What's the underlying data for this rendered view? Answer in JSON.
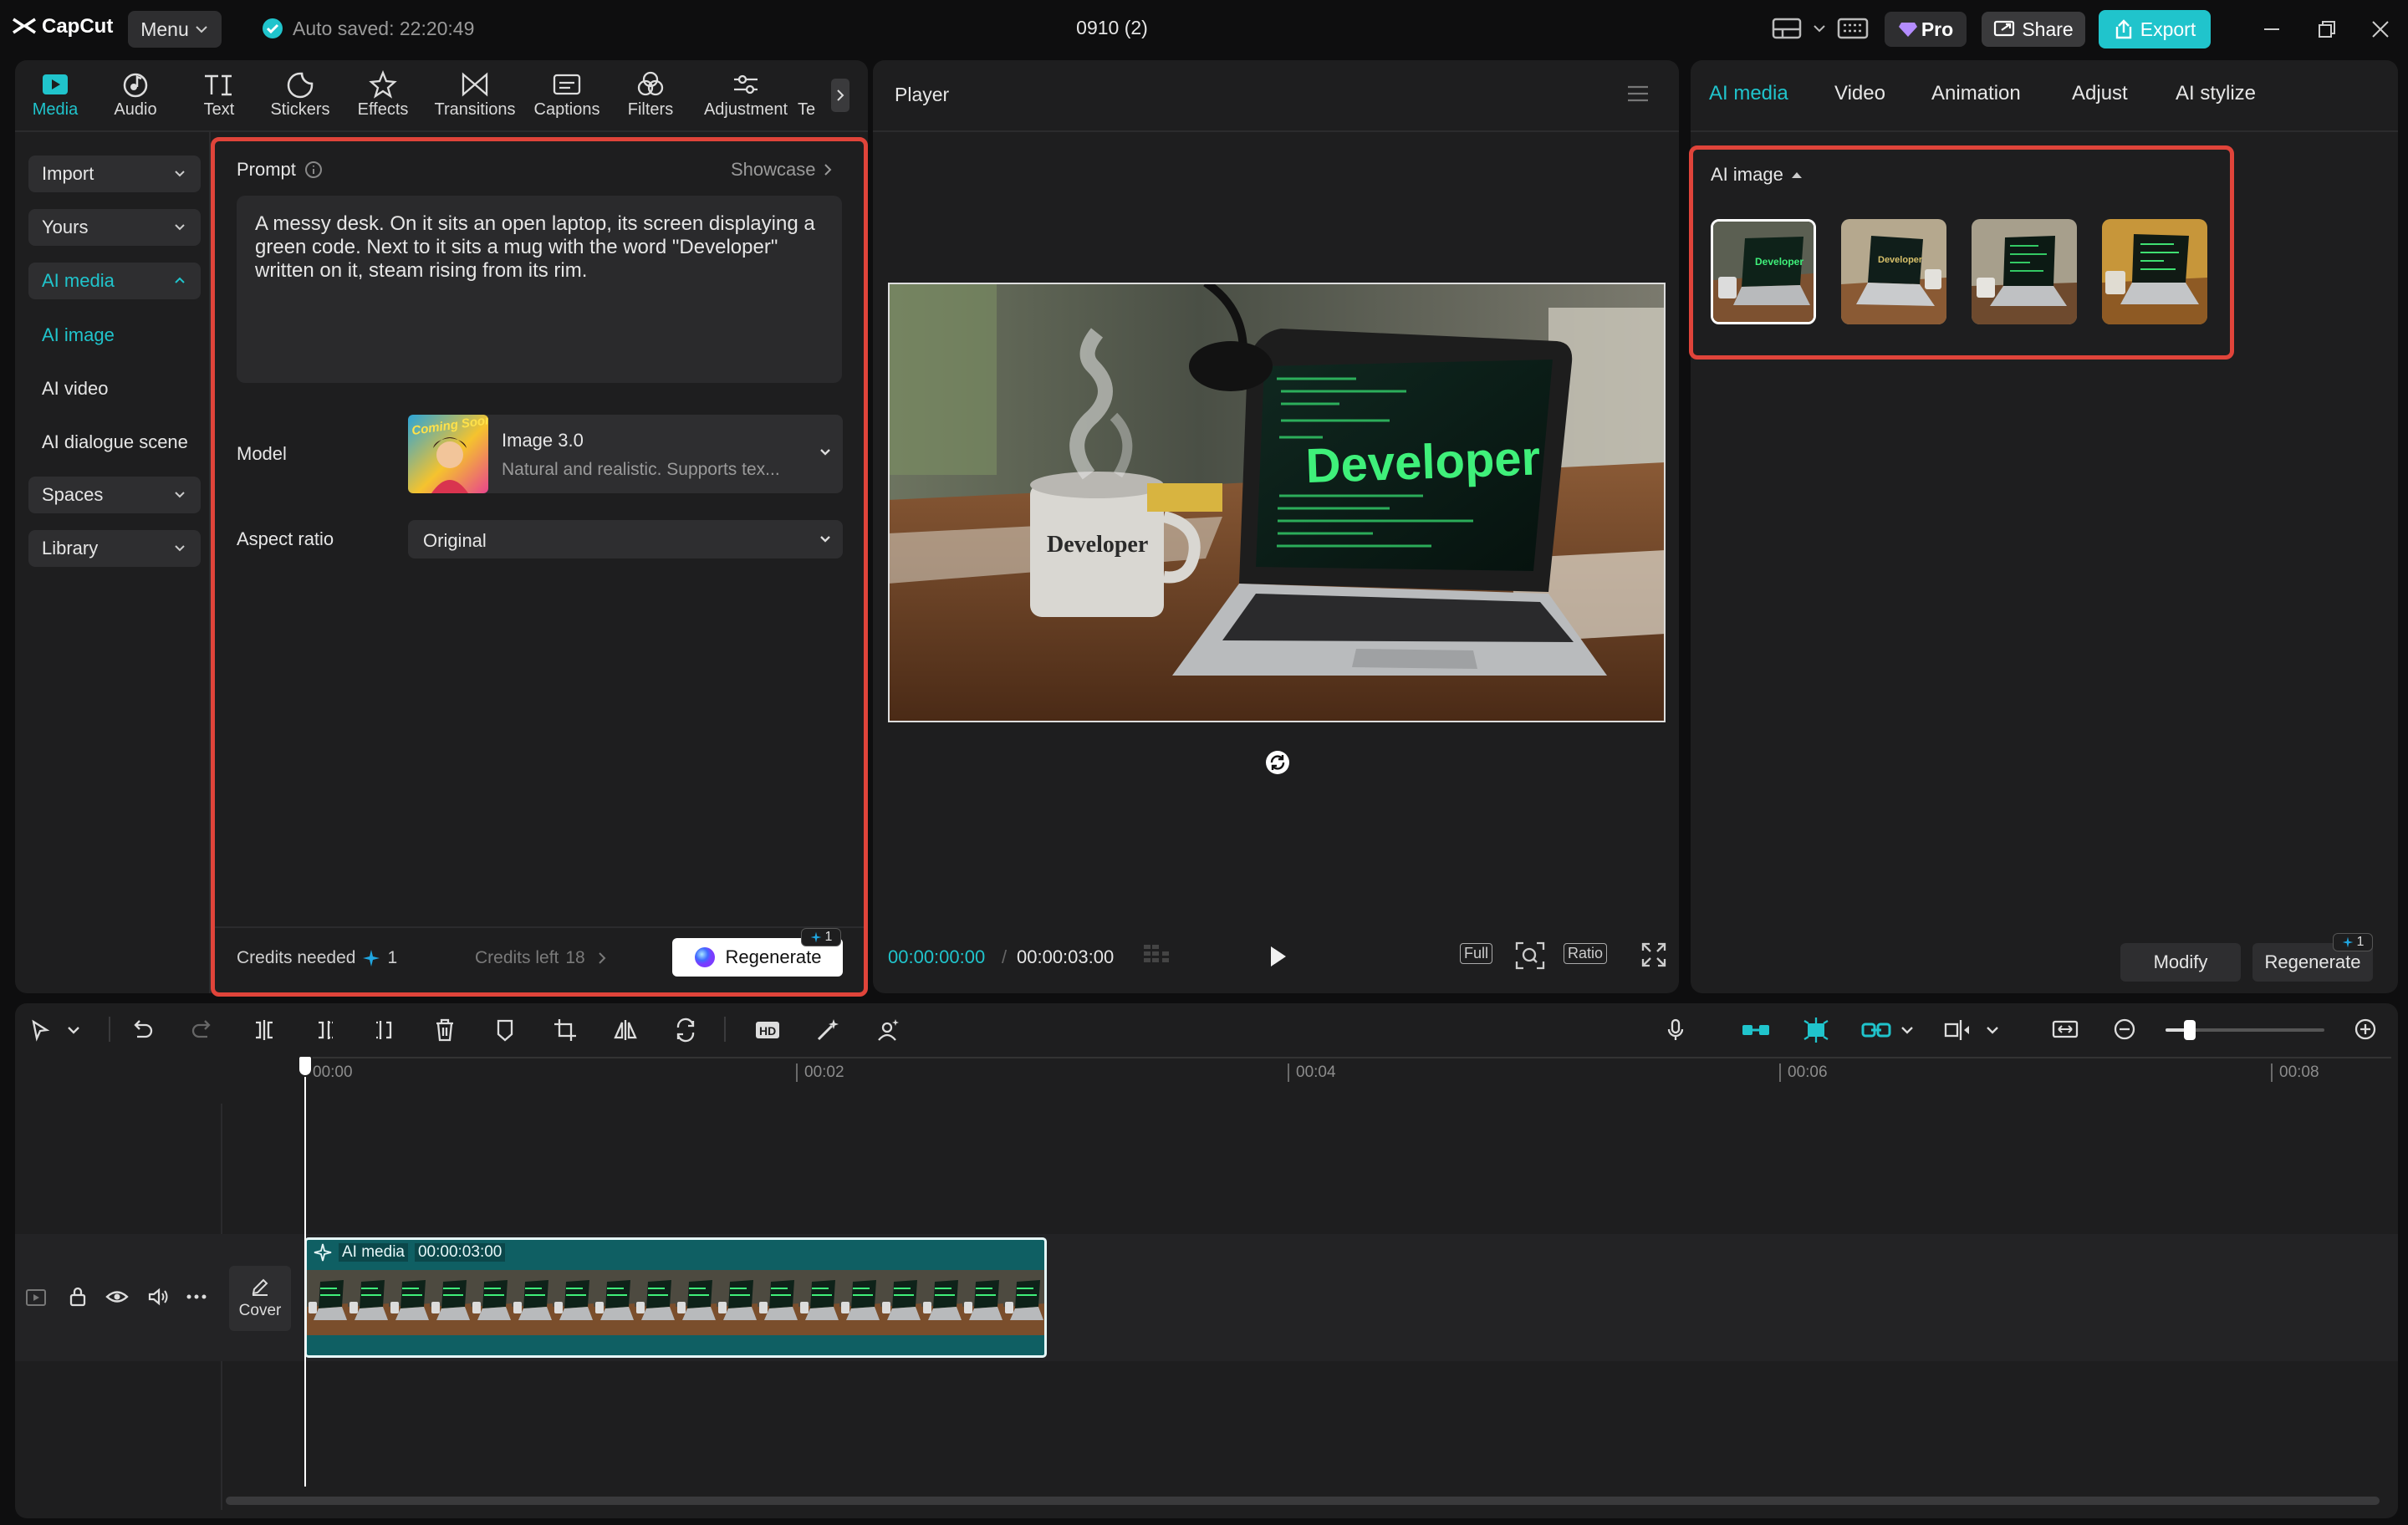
{
  "app": {
    "logo": "CapCut",
    "menu_label": "Menu",
    "autosave": "Auto saved: 22:20:49",
    "project_title": "0910 (2)",
    "pro_label": "Pro",
    "share_label": "Share",
    "export_label": "Export"
  },
  "toolbar": {
    "items": [
      "Media",
      "Audio",
      "Text",
      "Stickers",
      "Effects",
      "Transitions",
      "Captions",
      "Filters",
      "Adjustment",
      "Te"
    ],
    "active": "Media"
  },
  "sidebar": {
    "import": "Import",
    "yours": "Yours",
    "ai_media": "AI media",
    "ai_image": "AI image",
    "ai_video": "AI video",
    "ai_dialogue": "AI dialogue scene",
    "spaces": "Spaces",
    "library": "Library"
  },
  "prompt_panel": {
    "prompt_label": "Prompt",
    "showcase": "Showcase",
    "prompt_text": "A messy desk. On it sits an open laptop, its screen displaying a green code. Next to it sits a mug with the word \"Developer\" written on it, steam rising from its rim.",
    "model_label": "Model",
    "model_badge": "Coming Soon!",
    "model_name": "Image 3.0",
    "model_desc": "Natural and realistic. Supports tex...",
    "aspect_label": "Aspect ratio",
    "aspect_value": "Original",
    "credits_needed": "Credits needed",
    "credits_needed_value": "1",
    "credits_left": "Credits left",
    "credits_left_value": "18",
    "regenerate": "Regenerate",
    "regen_badge": "1"
  },
  "player": {
    "title": "Player",
    "image_mug_text": "Developer",
    "image_screen_text": "Developer",
    "current_time": "00:00:00:00",
    "total_time": "00:00:03:00",
    "full_label": "Full",
    "ratio_label": "Ratio"
  },
  "right_panel": {
    "tabs": [
      "AI media",
      "Video",
      "Animation",
      "Adjust",
      "AI stylize"
    ],
    "active_tab": "AI media",
    "section_label": "AI image",
    "thumb_texts": [
      "Developer",
      "Developer",
      "",
      ""
    ],
    "modify": "Modify",
    "regenerate": "Regenerate",
    "regen_badge": "1"
  },
  "timeline": {
    "ruler": [
      "00:00",
      "00:02",
      "00:04",
      "00:06",
      "00:08"
    ],
    "clip_label": "AI media",
    "clip_duration": "00:00:03:00",
    "cover_label": "Cover"
  },
  "colors": {
    "accent": "#20c4cc",
    "highlight_box": "#e0443a",
    "clip_bg": "#0f5f63"
  }
}
